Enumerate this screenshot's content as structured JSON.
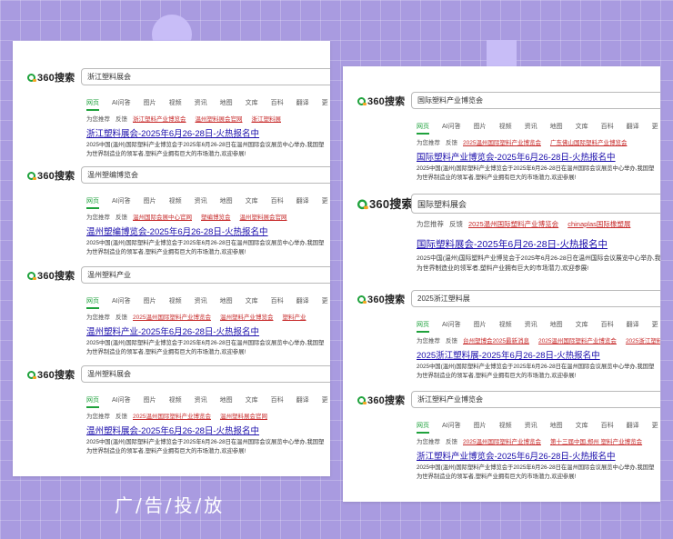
{
  "brand": {
    "logo_text": "360搜索"
  },
  "tabs": [
    "网页",
    "AI问答",
    "图片",
    "视频",
    "资讯",
    "地图",
    "文库",
    "百科",
    "翻译",
    "更"
  ],
  "rec_label": "为您推荐",
  "feedback_label": "反馈",
  "caption": "广/告/投/放",
  "title_suffix": "-2025年6月26-28日-火热报名中",
  "desc_line1": "2025中国(温州)国际塑料产业博览会于2025年6月26-28日在温州国际会议展览中心举办,我国塑",
  "desc_line2": "为世界制造业的领军者,塑料产业拥有巨大的市场潜力,欢迎参展!",
  "left_blocks": [
    {
      "query": "浙江塑料展会",
      "recs": [
        "浙江塑料产业博览会",
        "温州塑料展会官网",
        "浙江塑料展"
      ],
      "title_kw": "浙江塑料展会"
    },
    {
      "query": "温州塑编博览会",
      "recs": [
        "温州国际会展中心官网",
        "塑编博览会",
        "温州塑料展会官网"
      ],
      "title_kw": "温州塑编博览会"
    },
    {
      "query": "温州塑料产业",
      "recs": [
        "2025温州国际塑料产业博览会",
        "温州塑料产业博览会",
        "塑料产业"
      ],
      "title_kw": "温州塑料产业"
    },
    {
      "query": "温州塑料展会",
      "recs": [
        "2025温州国际塑料产业博览会",
        "温州塑料展会官网"
      ],
      "title_kw": "温州塑料展会"
    }
  ],
  "right_blocks": [
    {
      "query": "国际塑料产业博览会",
      "recs": [
        "2025温州国际塑料产业博览会",
        "广东佛山国际塑料产业博览会"
      ],
      "title_kw": "国际塑料产业博览会"
    },
    {
      "query": "国际塑料展会",
      "recs": [
        "2025温州国际塑料产业博览会",
        "chinaplas国际橡塑展"
      ],
      "title_kw": "国际塑料展会"
    },
    {
      "query": "2025浙江塑料展",
      "recs": [
        "台州塑博会2025最新消息",
        "2025温州国际塑料产业博览会",
        "2025浙江塑料展"
      ],
      "title_kw": "2025浙江塑料展"
    },
    {
      "query": "浙江塑料产业博览会",
      "recs": [
        "2025温州国际塑料产业博览会",
        "第十三届中国,郑州 塑料产业博览会"
      ],
      "title_kw": "浙江塑料产业博览会"
    }
  ]
}
